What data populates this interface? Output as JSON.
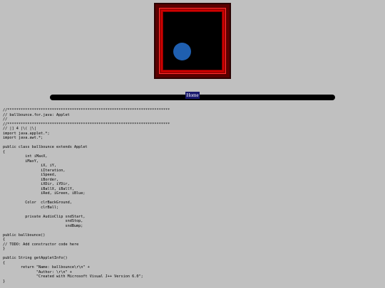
{
  "colors": {
    "page_background": "#c0c0c0",
    "ball": "#1f5fb0",
    "applet_inner": "#000000",
    "applet_border": "#d00000"
  },
  "nav": {
    "home_label": "Home"
  },
  "source_code": "//*************************************************************************\n// ballbounce.for.java: Applet\n//\n//*************************************************************************\n// |] 4 |\\( |\\|\nimport java.applet.*;\nimport java.awt.*;\n\npublic class ballbounce extends Applet\n{\n          int iMaxX,\n          iMaxY,\n                 iX, iY,\n                 iIteration,\n                 iSpeed,\n                 iBorder,\n                 iXDir, iYDir,\n                 iBallX, iBallY,\n                 iRed, iGreen, iBlue;\n\n          Color  clrBackGround,\n                 clrBall;\n\n          private AudioClip sndStart,\n                            sndStop,\n                            sndBump;\n\npublic ballbounce()\n{\n// TODO: Add constructor code here\n}\n\npublic String getAppletInfo()\n{\n        return \"Name: ballbounce\\r\\n\" +\n               \"Author: \\r\\n\" +\n               \"Created with Microsoft Visual J++ Version 6.0\";\n}\n\npublic void init()"
}
